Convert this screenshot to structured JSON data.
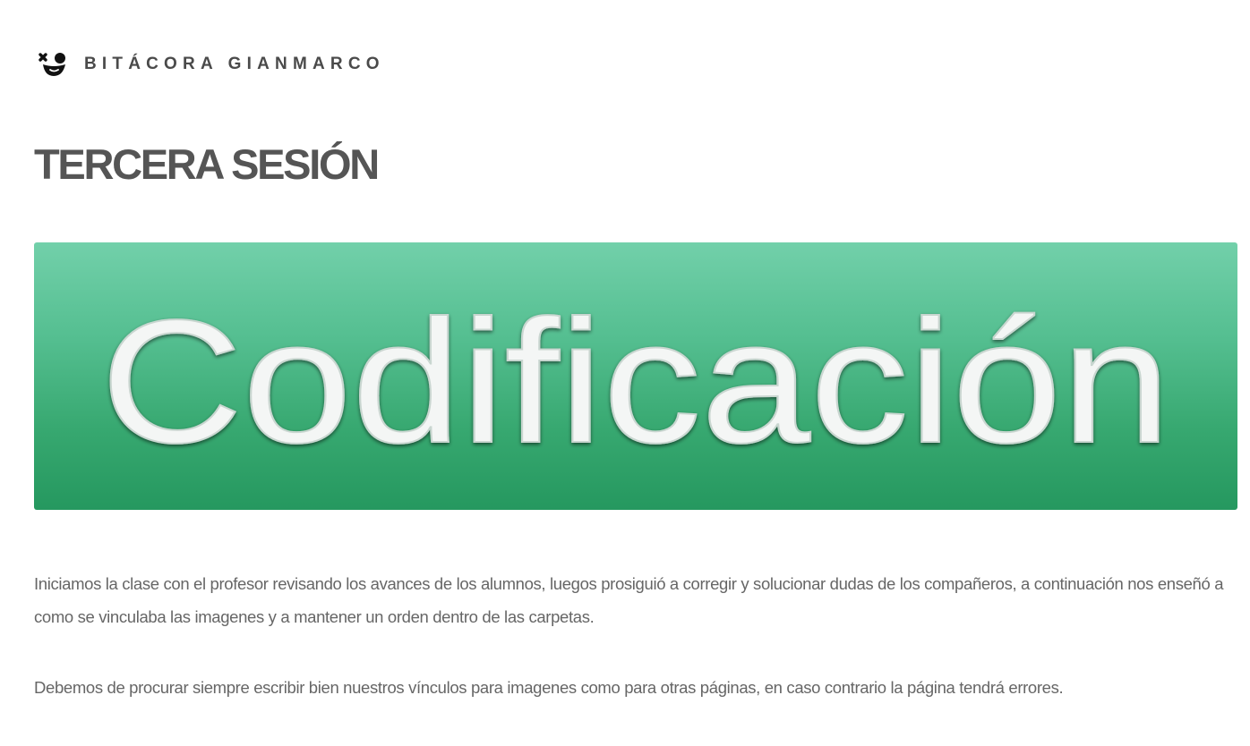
{
  "header": {
    "logo_icon": "bitacora-logo-icon",
    "site_title": "BITÁCORA GIANMARCO"
  },
  "page": {
    "title": "TERCERA SESIÓN"
  },
  "banner": {
    "text": "Codificación",
    "colors": {
      "top": "#72d0aa",
      "bottom": "#25985f",
      "text": "#f4f6f5"
    }
  },
  "content": {
    "paragraphs": [
      "Iniciamos la clase con el profesor revisando los avances de los alumnos, luegos prosiguió a corregir y solucionar dudas de los compañeros, a continuación nos enseñó a como se vinculaba las imagenes y a mantener un orden dentro de las carpetas.",
      "Debemos de procurar siempre escribir bien nuestros vínculos para imagenes como para otras páginas, en caso contrario la página tendrá errores."
    ]
  }
}
